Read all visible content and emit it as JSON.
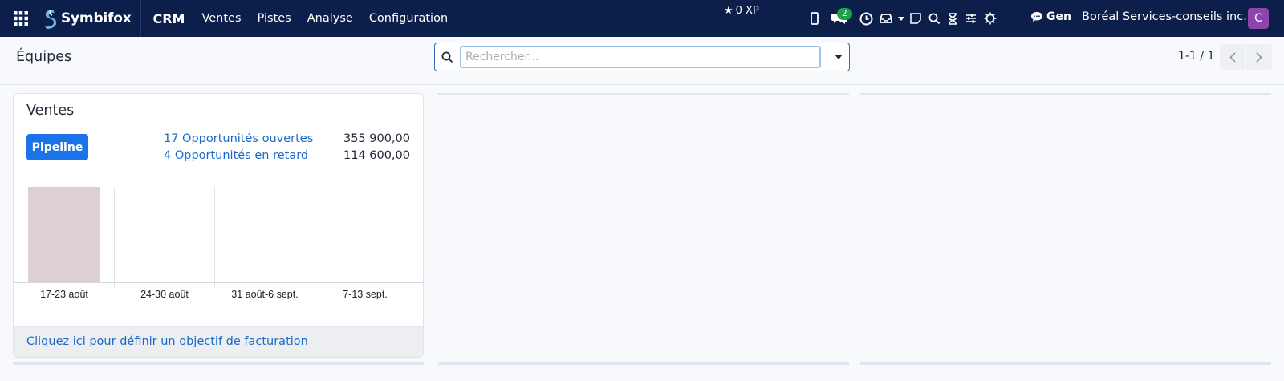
{
  "navbar": {
    "brand": "Symbifox",
    "app_name": "CRM",
    "menu": [
      "Ventes",
      "Pistes",
      "Analyse",
      "Configuration"
    ],
    "xp": "0 XP",
    "chat_badge": "2",
    "gen_label": "Gen",
    "company": "Boréal Services-conseils inc.",
    "avatar_letter": "C",
    "icons": [
      "apps-grid-icon",
      "mobile-icon",
      "chat-icon",
      "clock-icon",
      "inbox-icon",
      "caret-down-icon",
      "note-icon",
      "search-icon",
      "hourglass-icon",
      "sliders-icon",
      "sun-icon",
      "speech-bubble-icon"
    ]
  },
  "control": {
    "page_title": "Équipes",
    "search_placeholder": "Rechercher...",
    "pager_value": "1-1 / 1"
  },
  "team_card": {
    "name": "Ventes",
    "pipeline_button": "Pipeline",
    "stats": [
      {
        "label": "17 Opportunités ouvertes",
        "value": "355 900,00"
      },
      {
        "label": "4 Opportunités en retard",
        "value": "114 600,00"
      }
    ],
    "footer_link": "Cliquez ici pour définir un objectif de facturation"
  },
  "chart_data": {
    "type": "bar",
    "categories": [
      "17-23 août",
      "24-30 août",
      "31 août-6 sept.",
      "7-13 sept."
    ],
    "values": [
      1,
      0,
      0,
      0
    ],
    "colors": [
      "#dccfd6"
    ],
    "grid": "vertical separators",
    "title": "",
    "xlabel": "",
    "ylabel": ""
  },
  "colors": {
    "navbar": "#0c1f4a",
    "primary": "#1a73e8",
    "link": "#1b6ac9",
    "badge": "#21a04a",
    "avatar": "#8e44ad"
  }
}
